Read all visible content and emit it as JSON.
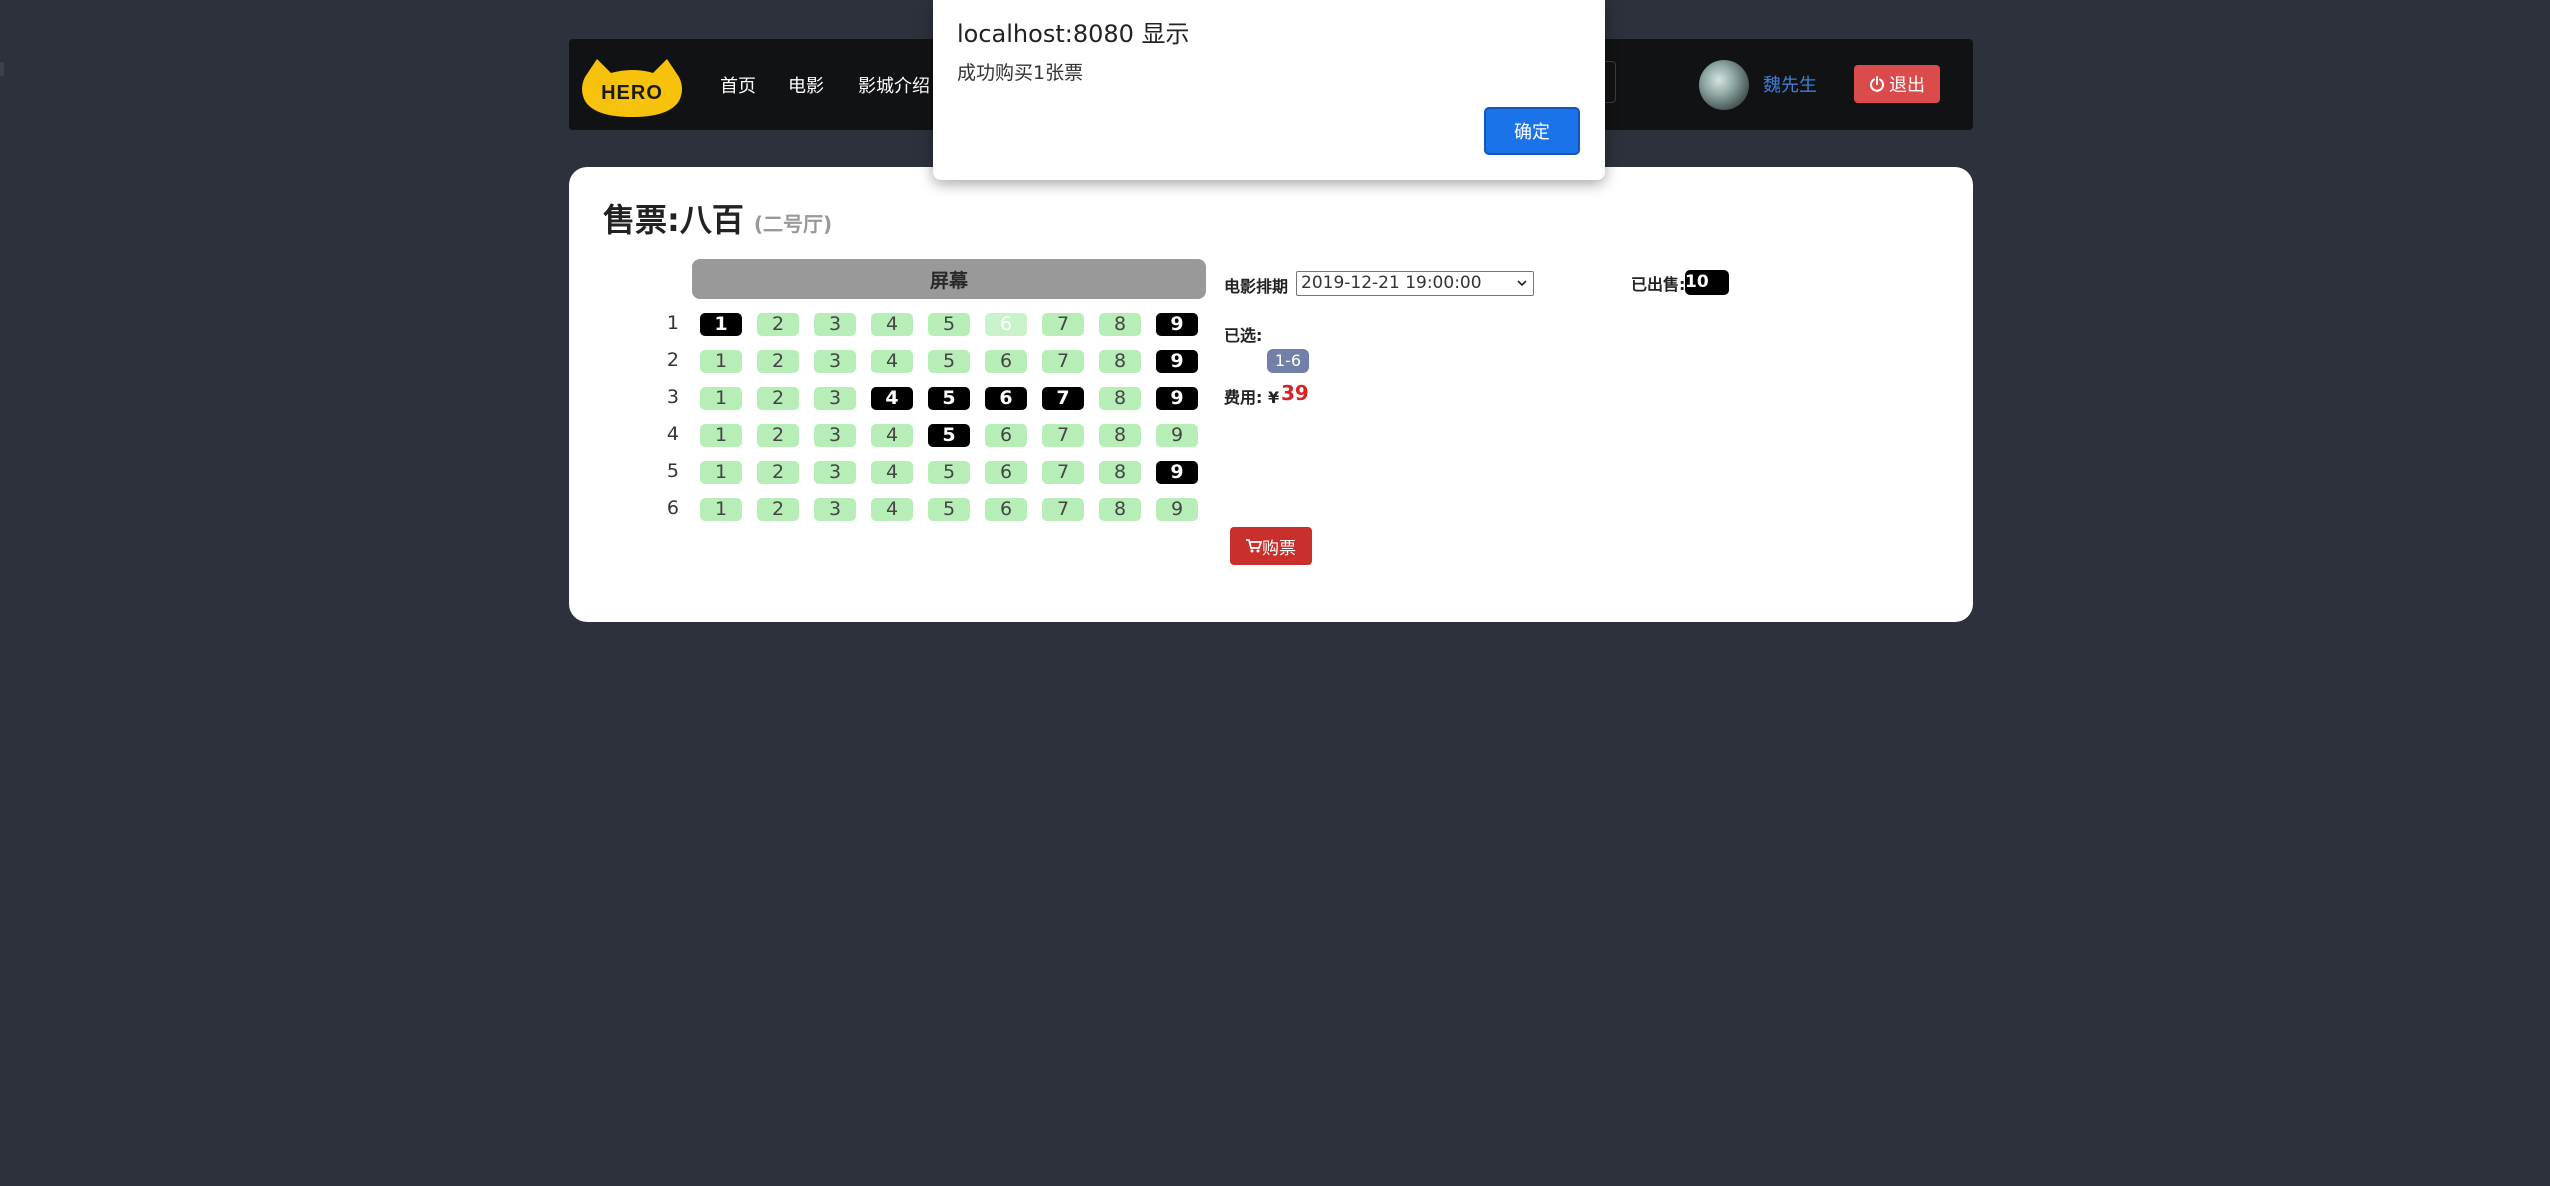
{
  "navbar": {
    "logo_text": "HERO",
    "items": [
      {
        "label": "首页"
      },
      {
        "label": "电影"
      },
      {
        "label": "影城介绍"
      }
    ],
    "username": "魏先生",
    "logout_label": "退出"
  },
  "ticket": {
    "title_prefix": "售票:",
    "movie_name": "八百",
    "hall": "(二号厅)",
    "screen_label": "屏幕",
    "schedule_label": "电影排期",
    "schedule_value": "2019-12-21 19:00:00",
    "sold_label": "已出售:",
    "sold_count": "10",
    "chosen_label": "已选:",
    "chosen_seat": "1-6",
    "fee_label": "费用: ¥",
    "fee_value": "39",
    "buy_label": "购票"
  },
  "seats": {
    "rows": [
      {
        "label": "1",
        "states": [
          "sold",
          "free",
          "free",
          "free",
          "free",
          "selected",
          "free",
          "free",
          "sold"
        ]
      },
      {
        "label": "2",
        "states": [
          "free",
          "free",
          "free",
          "free",
          "free",
          "free",
          "free",
          "free",
          "sold"
        ]
      },
      {
        "label": "3",
        "states": [
          "free",
          "free",
          "free",
          "sold",
          "sold",
          "sold",
          "sold",
          "free",
          "sold"
        ]
      },
      {
        "label": "4",
        "states": [
          "free",
          "free",
          "free",
          "free",
          "sold",
          "free",
          "free",
          "free",
          "free"
        ]
      },
      {
        "label": "5",
        "states": [
          "free",
          "free",
          "free",
          "free",
          "free",
          "free",
          "free",
          "free",
          "sold"
        ]
      },
      {
        "label": "6",
        "states": [
          "free",
          "free",
          "free",
          "free",
          "free",
          "free",
          "free",
          "free",
          "free"
        ]
      }
    ],
    "columns": [
      "1",
      "2",
      "3",
      "4",
      "5",
      "6",
      "7",
      "8",
      "9"
    ]
  },
  "alert": {
    "title": "localhost:8080 显示",
    "message": "成功购买1张票",
    "ok_label": "确定"
  },
  "colors": {
    "background": "#2d313b",
    "seat_free": "#b7eeb8",
    "seat_sold": "#000000",
    "logout": "#dc4b4b",
    "buy": "#c9302c",
    "price": "#d62424"
  }
}
